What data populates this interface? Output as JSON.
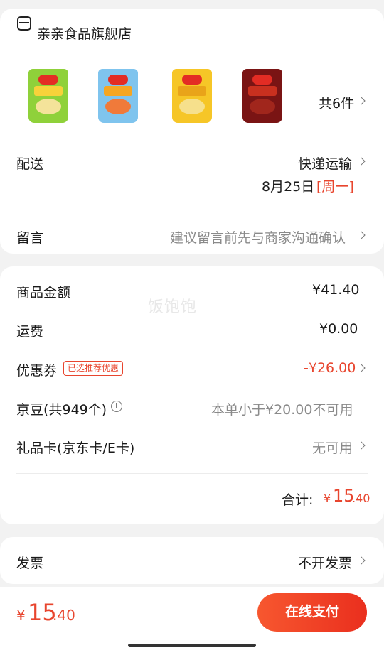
{
  "shop": {
    "name": "亲亲食品旗舰店",
    "icon": "shop-icon",
    "item_count": "共6件",
    "products": [
      {
        "name": "product-1",
        "bag_color": "#8fd13a",
        "band_color": "#f7d23a",
        "chip_color": "#f4e39a"
      },
      {
        "name": "product-2",
        "bag_color": "#7fc4ee",
        "band_color": "#f5a623",
        "chip_color": "#f07a3a"
      },
      {
        "name": "product-3",
        "bag_color": "#f6c627",
        "band_color": "#e9a419",
        "chip_color": "#f6e08c"
      },
      {
        "name": "product-4",
        "bag_color": "#7a1414",
        "band_color": "#c9301f",
        "chip_color": "#a1261c"
      }
    ]
  },
  "delivery": {
    "label": "配送",
    "method": "快递运输",
    "date": "8月25日",
    "weekday": "[周一]"
  },
  "message": {
    "label": "留言",
    "placeholder": "建议留言前先与商家沟通确认"
  },
  "price": {
    "goods_label": "商品金额",
    "goods_value": "¥41.40",
    "shipping_label": "运费",
    "shipping_value": "¥0.00",
    "coupon_label": "优惠券",
    "coupon_badge": "已选推荐优惠",
    "coupon_value": "-¥26.00",
    "beans_label": "京豆(共949个)",
    "beans_info_icon": "i",
    "beans_value": "本单小于¥20.00不可用",
    "giftcard_label": "礼品卡(京东卡/E卡)",
    "giftcard_value": "无可用",
    "total_label": "合计:",
    "total_currency": "¥",
    "total_int": "15",
    "total_dec": ".40",
    "watermark": "饭饱饱"
  },
  "invoice": {
    "label": "发票",
    "value": "不开发票"
  },
  "bottom": {
    "currency": "¥",
    "amount_int": "15",
    "amount_dec": ".40",
    "pay_label": "在线支付"
  },
  "colors": {
    "accent": "#e8452e",
    "pay_button": "#f04a2b"
  }
}
